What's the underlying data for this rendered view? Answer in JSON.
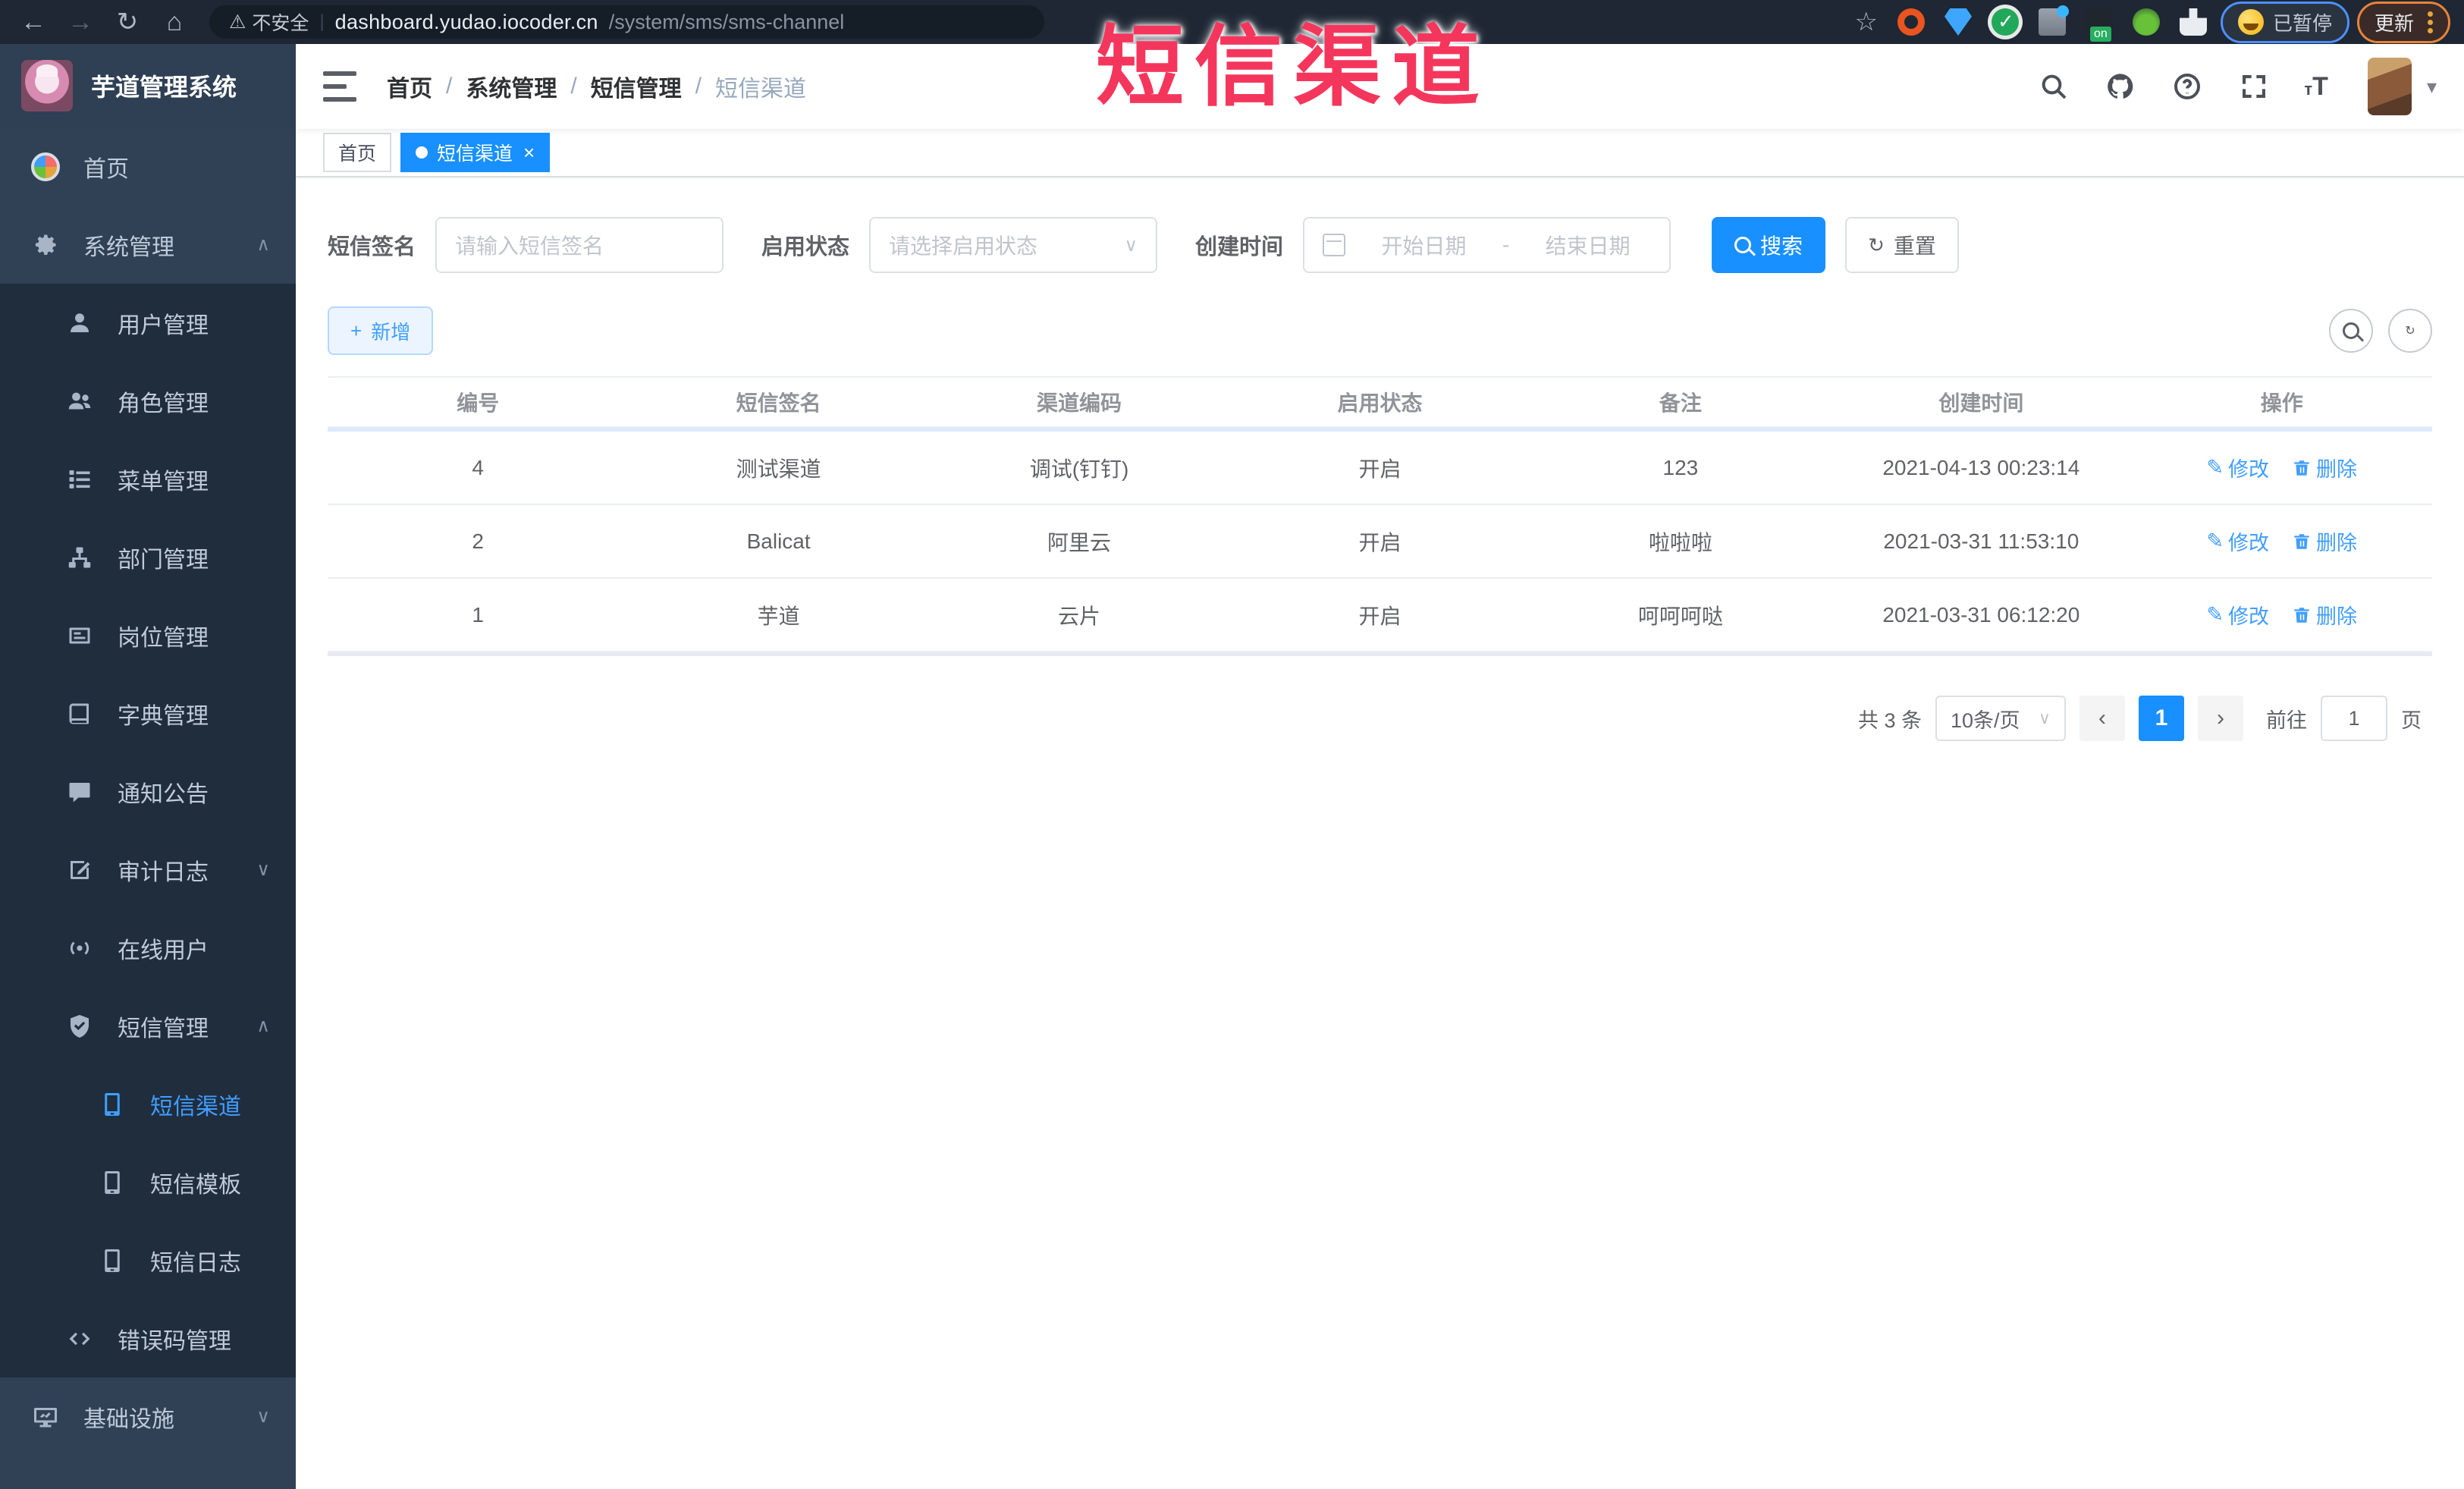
{
  "colors": {
    "accent": "#409eff",
    "solid_blue": "#1890ff",
    "sidebar_bg": "#304156",
    "submenu_bg": "#1f2d3d",
    "annotation_red": "#f5365c"
  },
  "annotation": {
    "text": "短信渠道"
  },
  "browser": {
    "security_label": "不安全",
    "url_host": "dashboard.yudao.iocoder.cn",
    "url_path": "/system/sms/sms-channel",
    "url_separator": "|",
    "paused_label": "已暂停",
    "update_label": "更新"
  },
  "icons": {
    "back": "←",
    "forward": "→",
    "reload": "↻",
    "home": "⌂",
    "warning": "⚠",
    "star": "☆",
    "chevron_up": "∧",
    "chevron_down": "∨",
    "caret_down": "▾",
    "close": "×",
    "dot": "",
    "plus": "+",
    "prev": "‹",
    "next": "›",
    "slash": "/",
    "edit_glyph": "✎",
    "reset_glyph": "↻"
  },
  "sidebar": {
    "title": "芋道管理系统",
    "items": [
      {
        "label": "首页"
      },
      {
        "label": "系统管理"
      },
      {
        "label": "用户管理"
      },
      {
        "label": "角色管理"
      },
      {
        "label": "菜单管理"
      },
      {
        "label": "部门管理"
      },
      {
        "label": "岗位管理"
      },
      {
        "label": "字典管理"
      },
      {
        "label": "通知公告"
      },
      {
        "label": "审计日志"
      },
      {
        "label": "在线用户"
      },
      {
        "label": "短信管理"
      },
      {
        "label": "短信渠道"
      },
      {
        "label": "短信模板"
      },
      {
        "label": "短信日志"
      },
      {
        "label": "错误码管理"
      },
      {
        "label": "基础设施"
      }
    ]
  },
  "header": {
    "breadcrumb": [
      "首页",
      "系统管理",
      "短信管理",
      "短信渠道"
    ],
    "breadcrumb_sep": "/"
  },
  "tabs": [
    {
      "label": "首页"
    },
    {
      "label": "短信渠道"
    }
  ],
  "filters": {
    "sign_label": "短信签名",
    "sign_placeholder": "请输入短信签名",
    "status_label": "启用状态",
    "status_placeholder": "请选择启用状态",
    "time_label": "创建时间",
    "start_placeholder": "开始日期",
    "range_sep": "-",
    "end_placeholder": "结束日期",
    "search_label": "搜索",
    "reset_label": "重置"
  },
  "toolbar": {
    "add_label": "新增"
  },
  "table": {
    "headers": [
      "编号",
      "短信签名",
      "渠道编码",
      "启用状态",
      "备注",
      "创建时间",
      "操作"
    ],
    "rows": [
      {
        "cells": [
          "4",
          "测试渠道",
          "调试(钉钉)",
          "开启",
          "123",
          "2021-04-13 00:23:14"
        ]
      },
      {
        "cells": [
          "2",
          "Balicat",
          "阿里云",
          "开启",
          "啦啦啦",
          "2021-03-31 11:53:10"
        ]
      },
      {
        "cells": [
          "1",
          "芋道",
          "云片",
          "开启",
          "呵呵呵哒",
          "2021-03-31 06:12:20"
        ]
      }
    ],
    "edit_label": "修改",
    "delete_label": "删除"
  },
  "pagination": {
    "total": "共 3 条",
    "page_size": "10条/页",
    "page": "1",
    "goto_label": "前往",
    "goto_value": "1",
    "unit_label": "页"
  }
}
